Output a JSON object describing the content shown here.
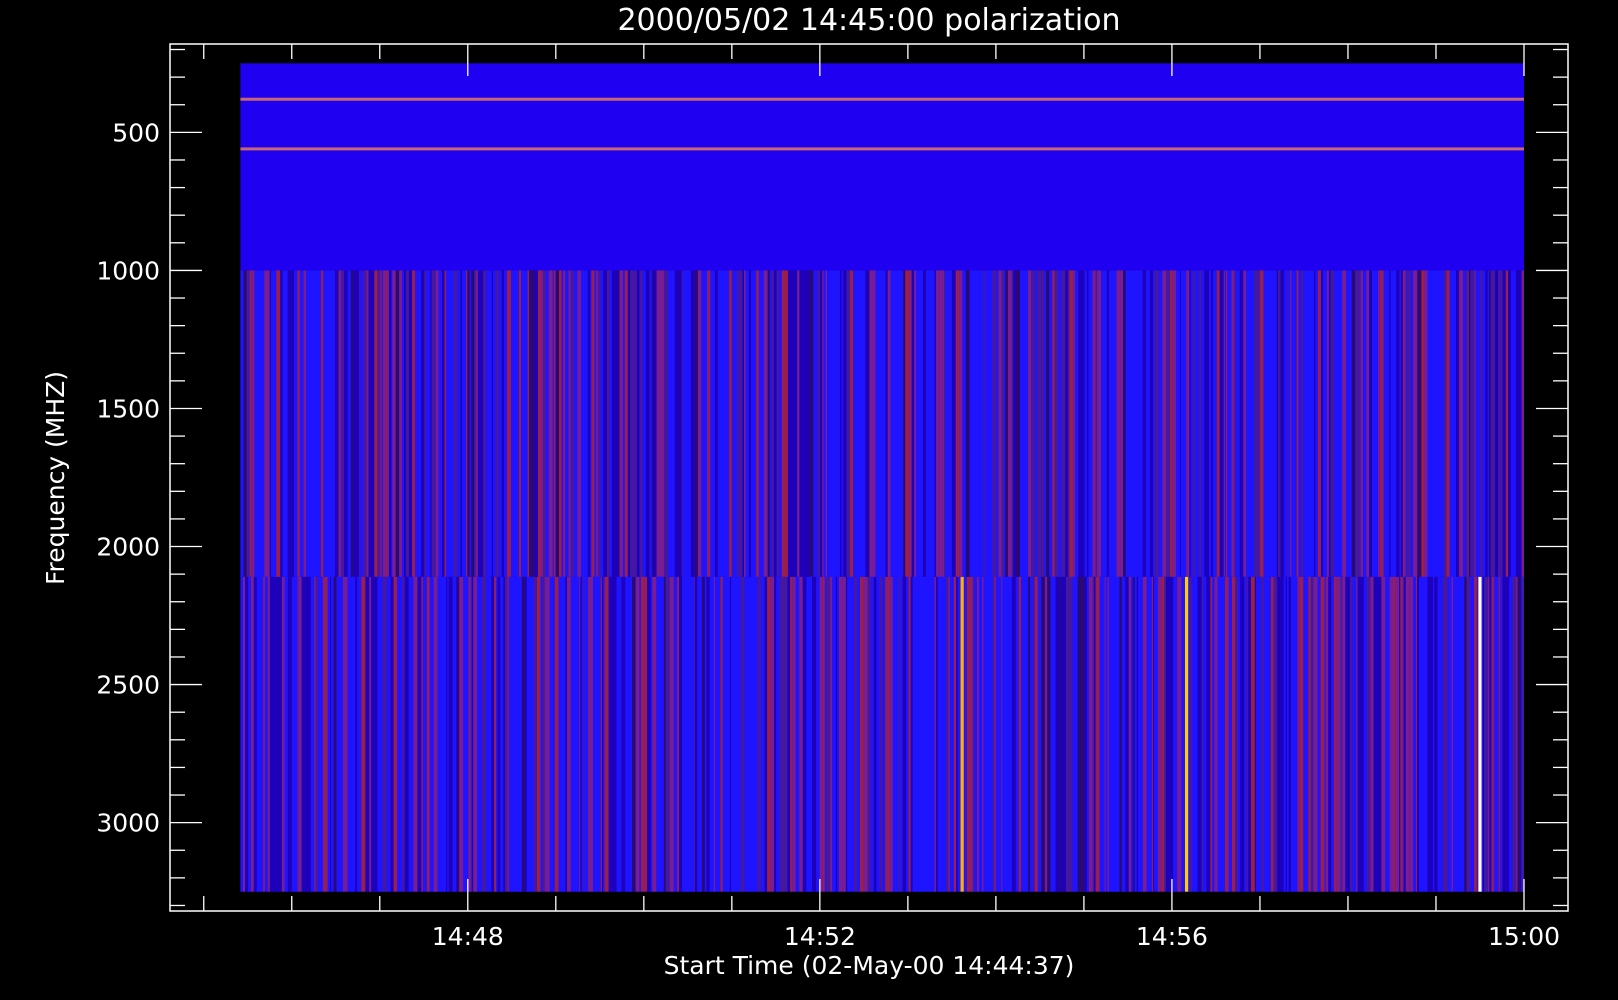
{
  "chart_data": {
    "type": "heatmap",
    "title": "2000/05/02 14:45:00 polarization",
    "xlabel": "Start Time (02-May-00 14:44:37)",
    "ylabel": "Frequency (MHZ)",
    "x_start": "14:44:37",
    "x_range": [
      "14:44:37",
      "15:00:30"
    ],
    "x_ticks": [
      "14:48",
      "14:52",
      "14:56",
      "15:00"
    ],
    "ylim": [
      3320,
      180
    ],
    "y_ticks": [
      500,
      1000,
      1500,
      2000,
      2500,
      3000
    ],
    "data_extent": {
      "x": [
        "14:45:25",
        "15:00:00"
      ],
      "y": [
        250,
        3250
      ]
    },
    "bands": [
      {
        "freq_range": [
          250,
          1000
        ],
        "appearance": "uniform blue",
        "color": "#1f00f0",
        "lines": [
          {
            "freq": 380,
            "color": "#ff8a4a"
          },
          {
            "freq": 560,
            "color": "#ff8a4a"
          }
        ]
      },
      {
        "freq_range": [
          1000,
          2110
        ],
        "appearance": "vertical blue and red stripes",
        "colors": [
          "#1e14ff",
          "#1d00b8",
          "#46189e",
          "#7a1d8e",
          "#9c1f4a",
          "#2a0a6e"
        ]
      },
      {
        "freq_range": [
          2110,
          3250
        ],
        "appearance": "vertical blue and red stripes with bright bursts",
        "colors": [
          "#1e14ff",
          "#1d00b8",
          "#46189e",
          "#7a1d8e",
          "#9c1f4a",
          "#2a0a6e"
        ],
        "bursts": [
          {
            "time": "14:53:37",
            "color": "#ffb100"
          },
          {
            "time": "14:56:10",
            "color": "#ffd000"
          },
          {
            "time": "14:59:30",
            "color": "#ffffff"
          }
        ]
      }
    ],
    "colors": {
      "background": "#000000",
      "axes": "#ffffff",
      "blue": "#1f00f0"
    }
  }
}
